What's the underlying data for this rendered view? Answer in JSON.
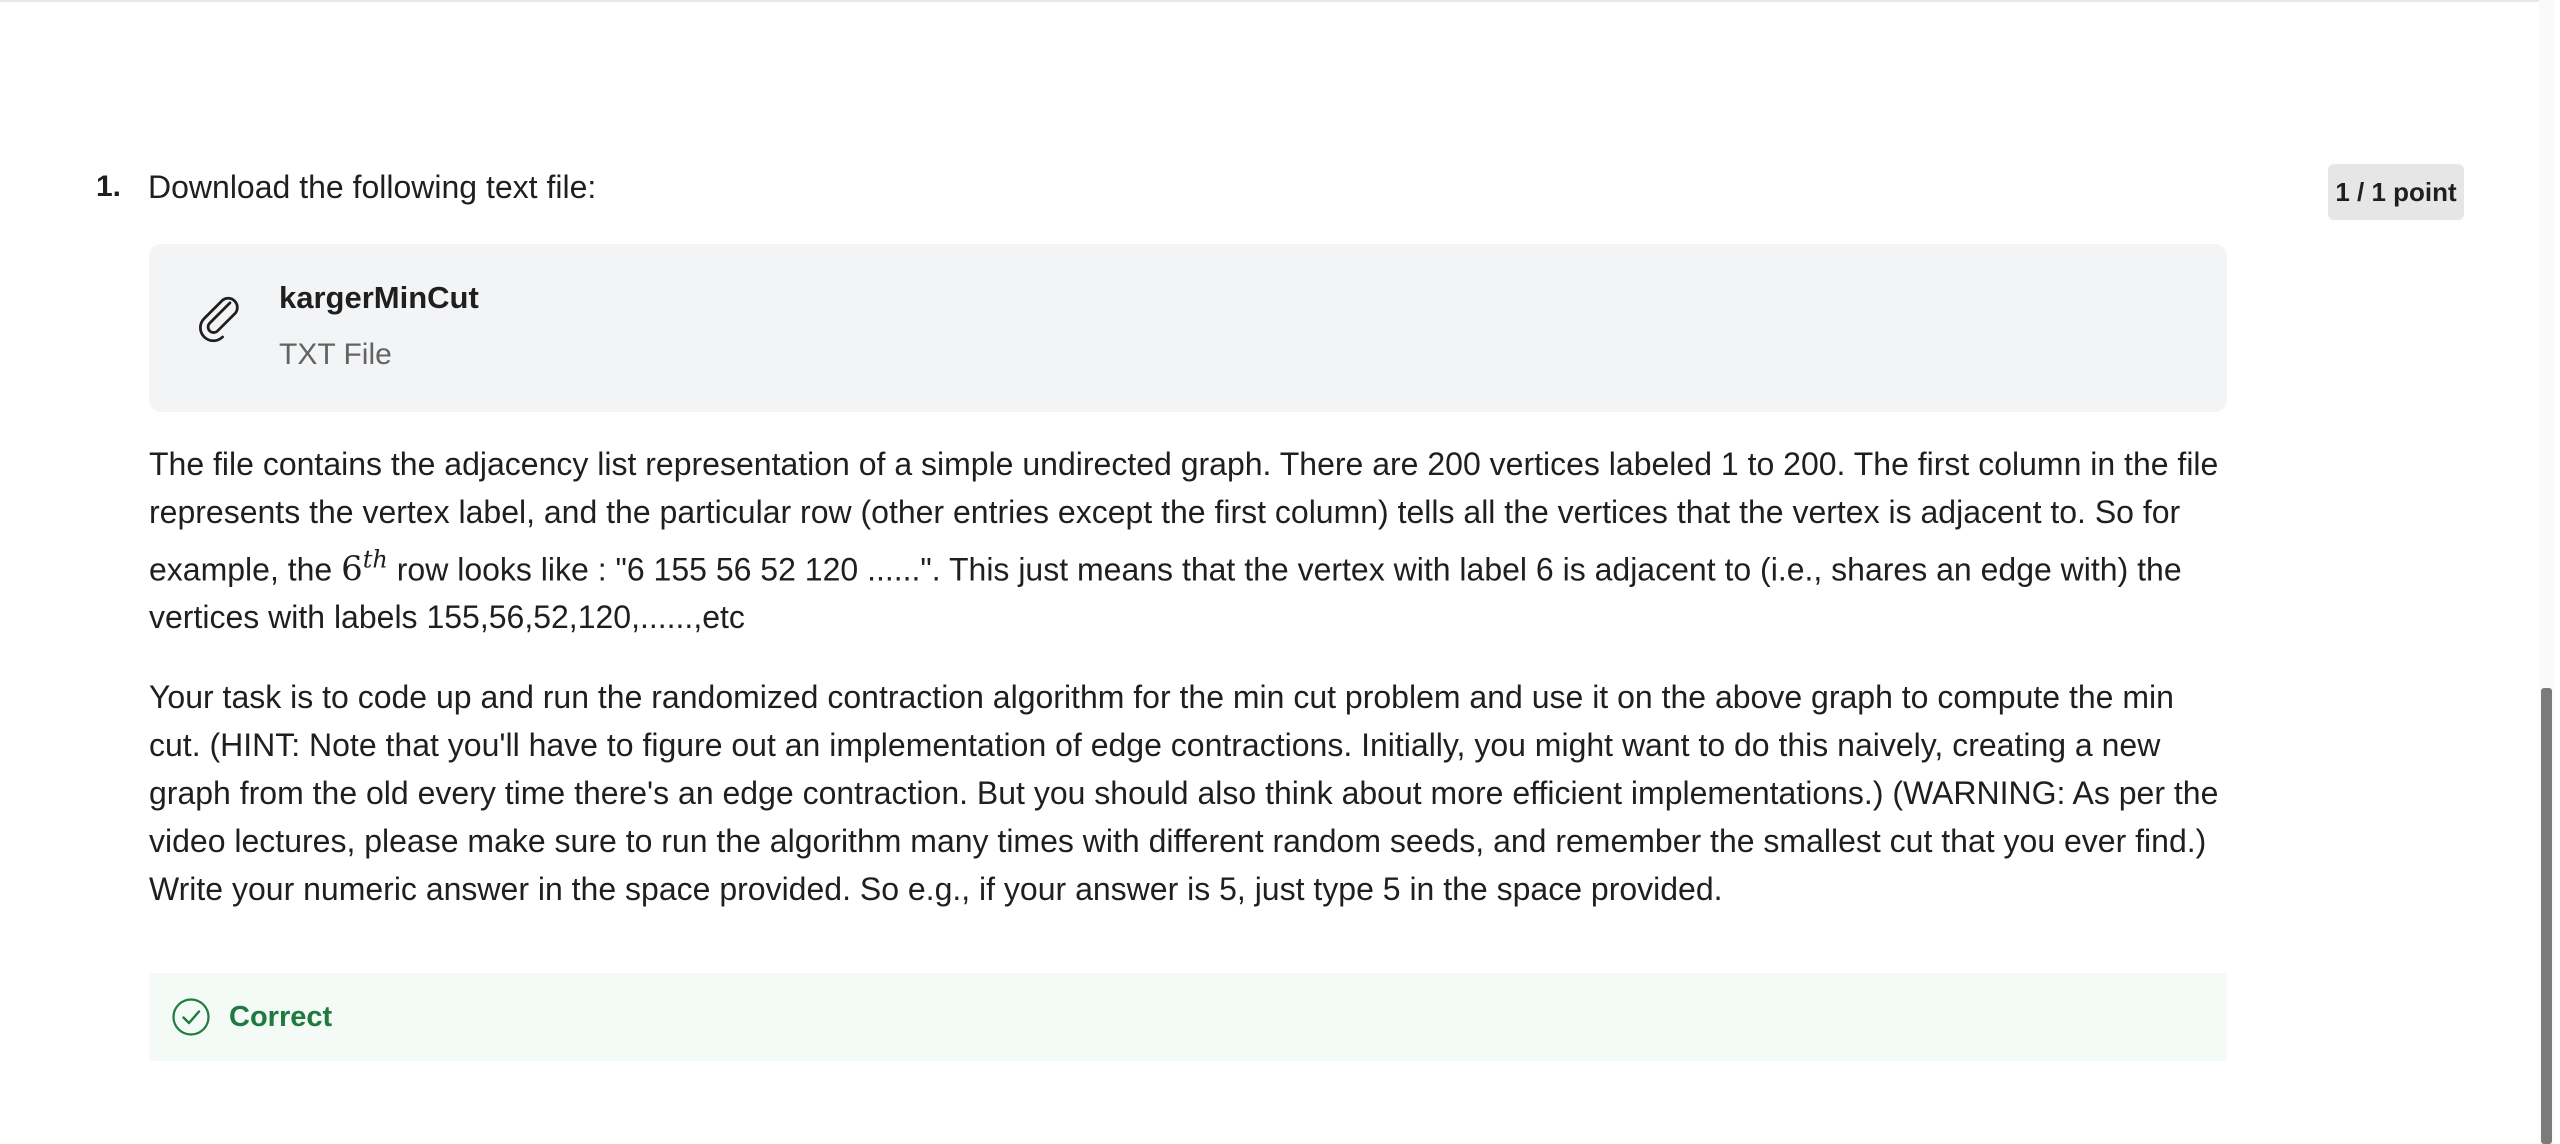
{
  "question": {
    "number": "1.",
    "prompt": "Download the following text file:",
    "score": "1 / 1 point"
  },
  "attachment": {
    "icon": "paperclip-icon",
    "file_name": "kargerMinCut",
    "file_type": "TXT File"
  },
  "description": {
    "p1_before": "The file contains the adjacency list representation of a simple undirected graph. There are 200 vertices labeled 1 to 200. The first column in the file represents the vertex label, and the particular row (other entries except the first column) tells all the vertices that the vertex is adjacent to. So for example, the ",
    "p1_math_base": "6",
    "p1_math_sup": "th",
    "p1_after": " row looks like : \"6   155 56   52   120 ......\". This just means that the vertex with label 6 is adjacent to (i.e., shares an edge with) the vertices with labels 155,56,52,120,......,etc",
    "p2": "Your task is to code up and run the randomized contraction algorithm for the min cut problem and use it on the above graph to compute the min cut.  (HINT: Note that you'll have to figure out an implementation of edge contractions.  Initially, you might want to do this naively, creating a new graph from the old every time there's an edge contraction.  But you should also think about more efficient implementations.)   (WARNING: As per the video lectures, please make sure to run the algorithm many times with different random seeds, and remember the smallest cut that you ever find.)  Write your numeric answer in the space provided.  So e.g., if your answer is 5, just type 5 in the space provided."
  },
  "result": {
    "icon": "check-circle-icon",
    "label": "Correct",
    "color": "#1f7a40"
  }
}
